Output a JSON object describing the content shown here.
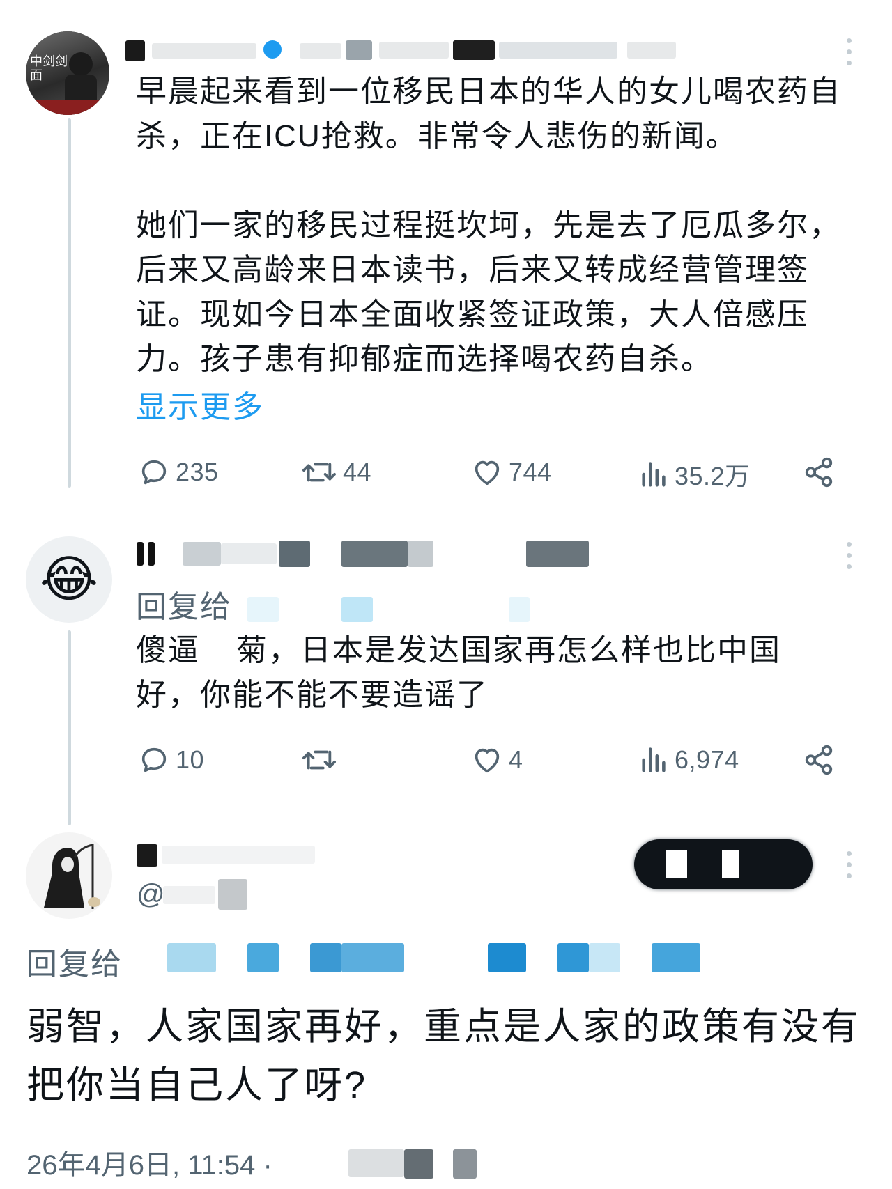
{
  "main_post": {
    "avatar_text": "中剑剑面",
    "text": "早晨起来看到一位移民日本的华人的女儿喝农药自杀，正在ICU抢救。非常令人悲伤的新闻。\n\n她们一家的移民过程挺坎坷，先是去了厄瓜多尔，后来又高龄来日本读书，后来又转成经营管理签证。现如今日本全面收紧签证政策，大人倍感压力。孩子患有抑郁症而选择喝农药自杀。",
    "show_more": "显示更多",
    "stats": {
      "replies": "235",
      "reposts": "44",
      "likes": "744",
      "views": "35.2万"
    }
  },
  "reply_1": {
    "avatar_emoji": "😂",
    "reply_to_label": "回复给",
    "text_part1": "傻逼",
    "text_part2": "菊，日本是发达国家再怎么样也比中国好，你能不能不要造谣了",
    "stats": {
      "replies": "10",
      "reposts": "",
      "likes": "4",
      "views": "6,974"
    }
  },
  "reply_2": {
    "handle_prefix": "@",
    "reply_to_label": "回复给",
    "text": "弱智，人家国家再好，重点是人家的政策有没有把你当自己人了呀?",
    "timestamp": "26年4月6日, 11:54 · "
  },
  "colors": {
    "link": "#1d9bf0",
    "muted": "#536471",
    "text": "#0f1419",
    "thread_line": "#cfd9de"
  }
}
